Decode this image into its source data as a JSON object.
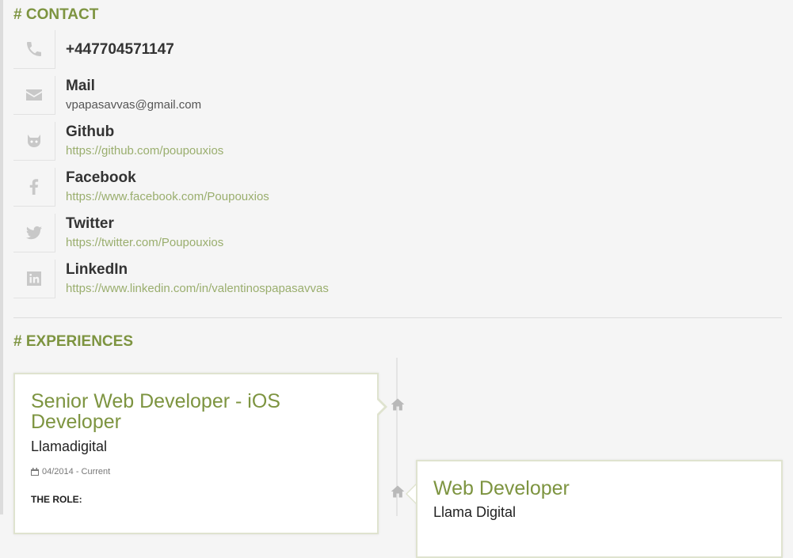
{
  "contact": {
    "title": "# CONTACT",
    "phone": {
      "icon": "phone-icon",
      "value": "+447704571147"
    },
    "items": [
      {
        "icon": "mail-icon",
        "label": "Mail",
        "value": "vpapasavvas@gmail.com",
        "is_link": false
      },
      {
        "icon": "github-icon",
        "label": "Github",
        "value": "https://github.com/poupouxios",
        "is_link": true
      },
      {
        "icon": "facebook-icon",
        "label": "Facebook",
        "value": "https://www.facebook.com/Poupouxios",
        "is_link": true
      },
      {
        "icon": "twitter-icon",
        "label": "Twitter",
        "value": "https://twitter.com/Poupouxios",
        "is_link": true
      },
      {
        "icon": "linkedin-icon",
        "label": "LinkedIn",
        "value": "https://www.linkedin.com/in/valentinospapasavvas",
        "is_link": true
      }
    ]
  },
  "experiences": {
    "title": "# EXPERIENCES",
    "items": [
      {
        "title": "Senior Web Developer - iOS Developer",
        "company": "Llamadigital",
        "date": "04/2014 - Current",
        "role_heading": "THE ROLE:",
        "timeline_icon": "home-icon"
      },
      {
        "title": "Web Developer",
        "company": "Llama Digital",
        "timeline_icon": "home-icon"
      }
    ]
  },
  "colors": {
    "accent": "#7d9440",
    "link": "#9aae6e",
    "icon": "#c8c8c8"
  }
}
